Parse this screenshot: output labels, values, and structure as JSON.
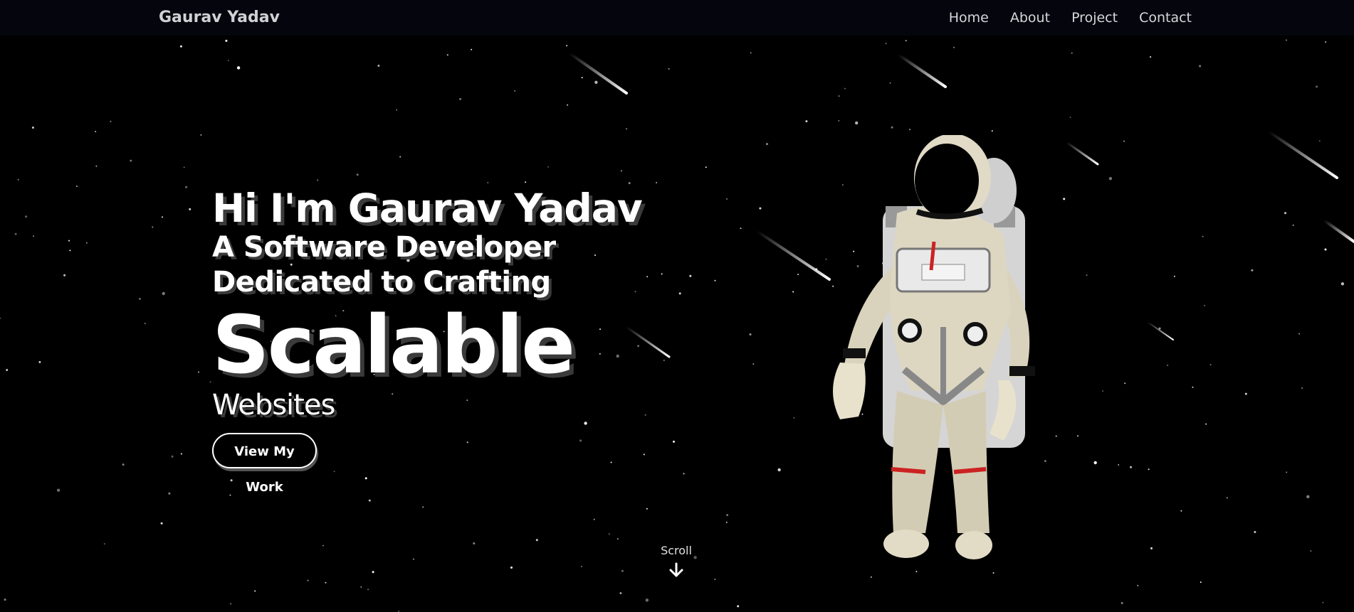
{
  "brand": {
    "name": "Gaurav Yadav"
  },
  "nav": {
    "items": [
      {
        "label": "Home"
      },
      {
        "label": "About"
      },
      {
        "label": "Project"
      },
      {
        "label": "Contact"
      }
    ]
  },
  "hero": {
    "greeting": "Hi I'm Gaurav Yadav",
    "line2": "A Software Developer",
    "line3": "Dedicated to Crafting",
    "highlight": "Scalable",
    "subword": "Websites",
    "cta_label": "View My Work"
  },
  "scroll": {
    "label": "Scroll",
    "icon": "arrow-down-icon"
  },
  "colors": {
    "background": "#000000",
    "navbar": "#05060d",
    "text": "#ffffff",
    "shadow": "#3a3a3a"
  },
  "icons": {
    "astronaut": "astronaut-illustration",
    "shooting_star": "shooting-star"
  }
}
